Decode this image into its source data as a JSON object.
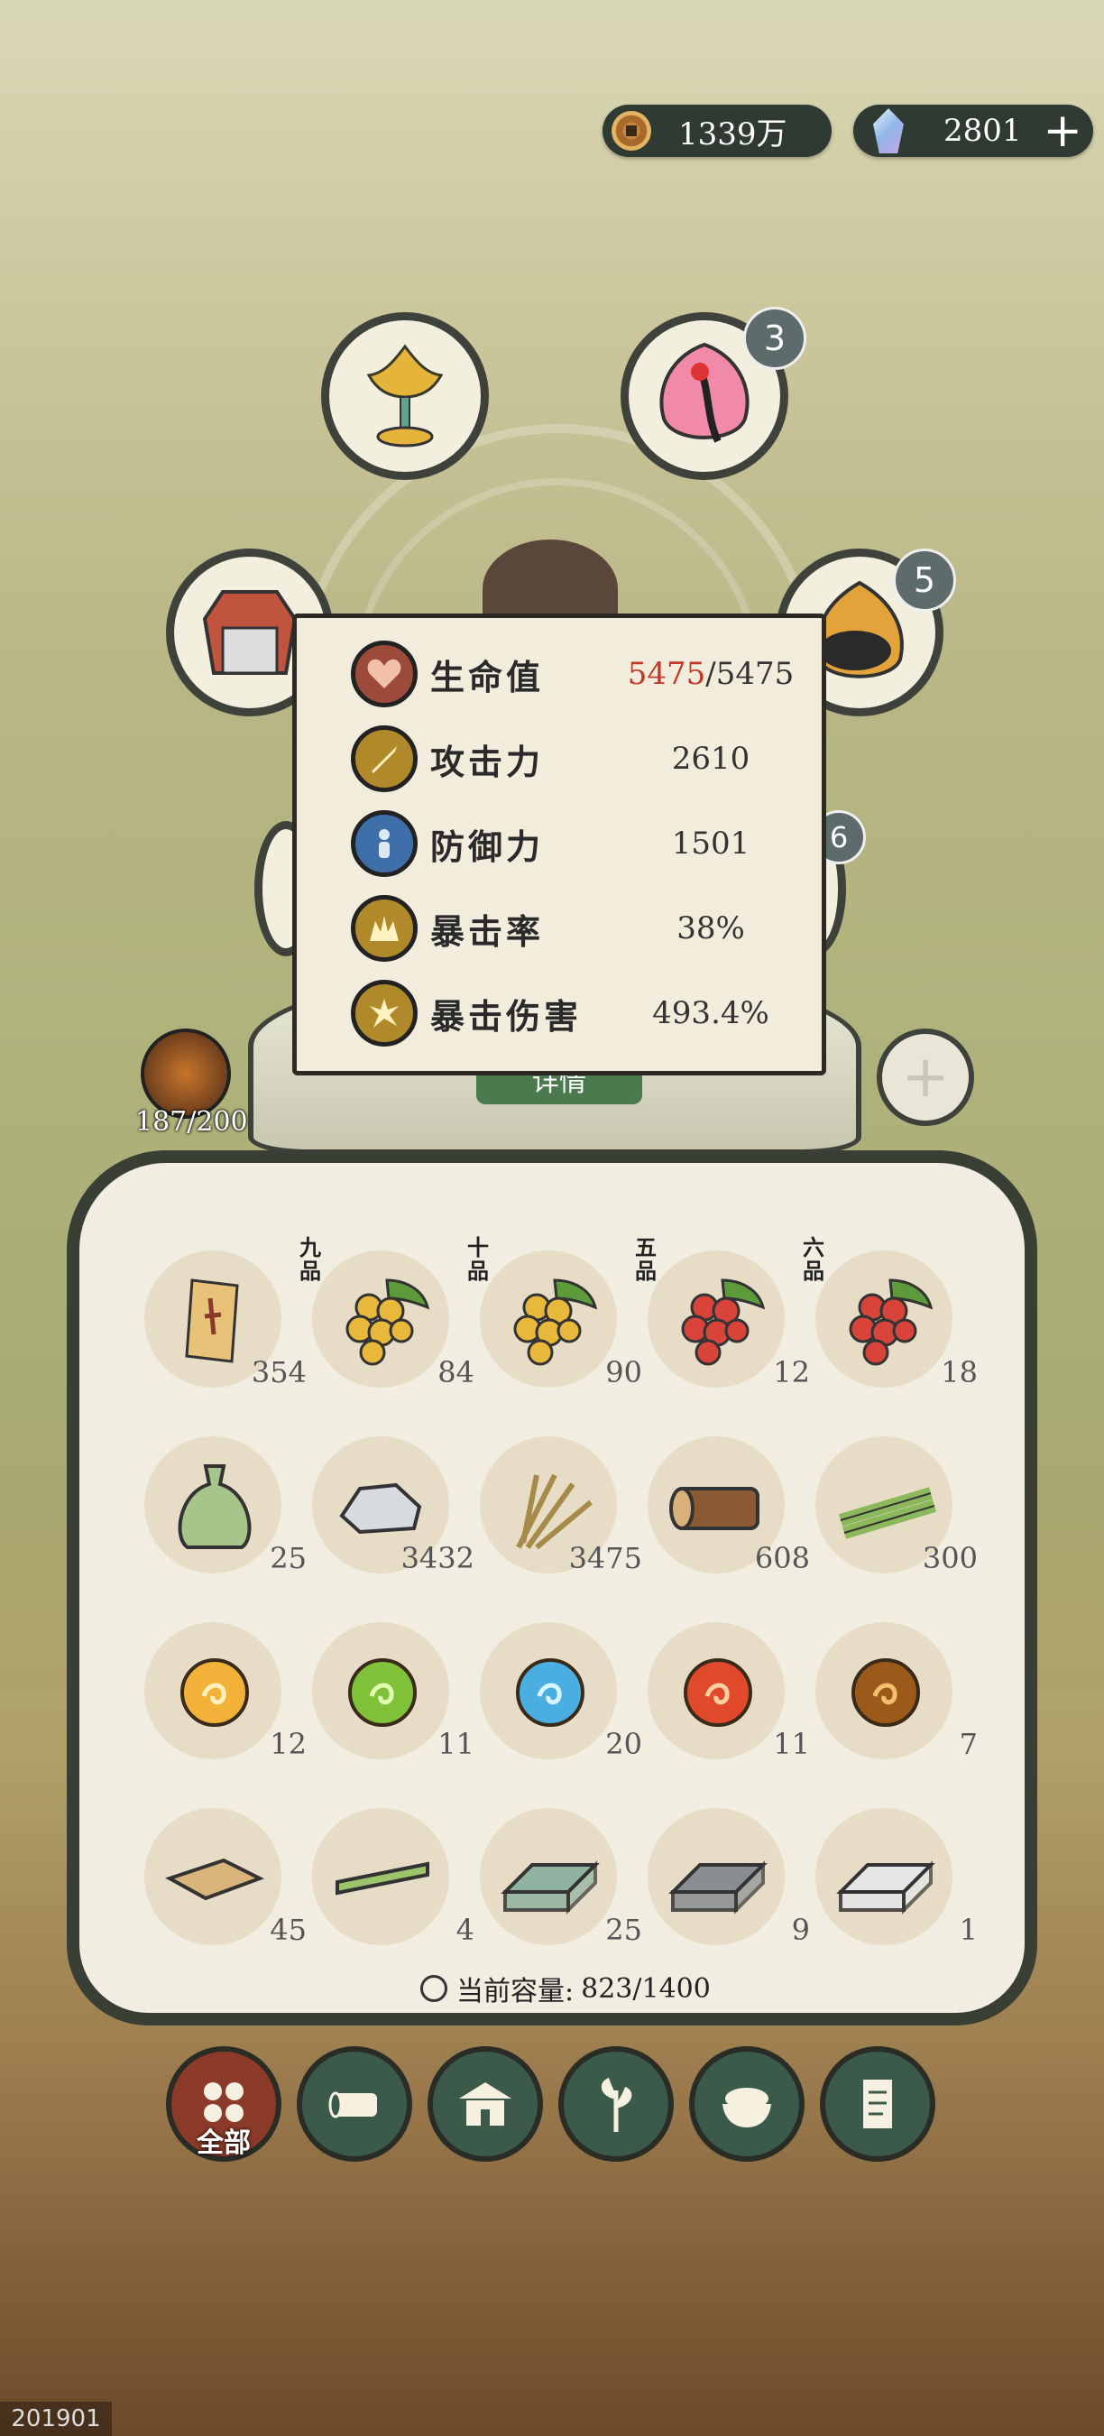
{
  "currency": {
    "coins": {
      "value": "1339万",
      "icon": "copper-coin-icon"
    },
    "gems": {
      "value": "2801",
      "icon": "crystal-icon",
      "add_label": "+"
    }
  },
  "equipment": {
    "slots": [
      {
        "name": "lotus-chalice",
        "icon": "lotus-chalice-icon",
        "badge": ""
      },
      {
        "name": "crane-peach",
        "icon": "crane-peach-icon",
        "badge": "3"
      },
      {
        "name": "armor",
        "icon": "armor-icon",
        "badge": ""
      },
      {
        "name": "beast-flame",
        "icon": "beast-flame-icon",
        "badge": "5"
      }
    ],
    "hidden_badge": "6",
    "details_button": "详情"
  },
  "character": {
    "level_progress": "187/200"
  },
  "stats": [
    {
      "label": "生命值",
      "current": "5475",
      "value": "/5475",
      "icon": "heart-icon",
      "color": "#c0392b"
    },
    {
      "label": "攻击力",
      "value": "2610",
      "icon": "sword-icon",
      "color": "#c8a13a"
    },
    {
      "label": "防御力",
      "value": "1501",
      "icon": "defense-person-icon",
      "color": "#3e6fa8"
    },
    {
      "label": "暴击率",
      "value": "38%",
      "icon": "crit-rate-icon",
      "color": "#c8a13a"
    },
    {
      "label": "暴击伤害",
      "value": "493.4%",
      "icon": "crit-damage-icon",
      "color": "#c8a13a"
    }
  ],
  "inventory": {
    "items": [
      {
        "icon": "scroll-figure-icon",
        "count": "354",
        "grade": ""
      },
      {
        "icon": "golden-berries-icon",
        "count": "84",
        "grade": "九品"
      },
      {
        "icon": "golden-berries-icon",
        "count": "90",
        "grade": "十品"
      },
      {
        "icon": "red-berries-icon",
        "count": "12",
        "grade": "五品"
      },
      {
        "icon": "red-berries-icon",
        "count": "18",
        "grade": "六品"
      },
      {
        "icon": "seed-pouch-icon",
        "count": "25",
        "grade": ""
      },
      {
        "icon": "stone-icon",
        "count": "3432",
        "grade": ""
      },
      {
        "icon": "grass-bundle-icon",
        "count": "3475",
        "grade": ""
      },
      {
        "icon": "wood-log-icon",
        "count": "608",
        "grade": ""
      },
      {
        "icon": "bamboo-icon",
        "count": "300",
        "grade": ""
      },
      {
        "icon": "gold-orb-icon",
        "count": "12",
        "grade": ""
      },
      {
        "icon": "green-orb-icon",
        "count": "11",
        "grade": ""
      },
      {
        "icon": "blue-orb-icon",
        "count": "20",
        "grade": ""
      },
      {
        "icon": "red-orb-icon",
        "count": "11",
        "grade": ""
      },
      {
        "icon": "brown-orb-icon",
        "count": "7",
        "grade": ""
      },
      {
        "icon": "wood-plank-icon",
        "count": "45",
        "grade": ""
      },
      {
        "icon": "bamboo-plank-icon",
        "count": "4",
        "grade": ""
      },
      {
        "icon": "jade-ingot-icon",
        "count": "25",
        "grade": ""
      },
      {
        "icon": "iron-ingot-icon",
        "count": "9",
        "grade": ""
      },
      {
        "icon": "silver-ingot-icon",
        "count": "1",
        "grade": ""
      }
    ],
    "capacity_label": "当前容量:",
    "capacity_value": "823/1400"
  },
  "tabs": [
    {
      "label": "全部",
      "icon": "all-grid-icon",
      "active": true
    },
    {
      "label": "",
      "icon": "wood-tab-icon",
      "active": false
    },
    {
      "label": "",
      "icon": "building-tab-icon",
      "active": false
    },
    {
      "label": "",
      "icon": "herb-tab-icon",
      "active": false
    },
    {
      "label": "",
      "icon": "food-bowl-tab-icon",
      "active": false
    },
    {
      "label": "",
      "icon": "scroll-tab-icon",
      "active": false
    }
  ],
  "footer_id": "201901"
}
